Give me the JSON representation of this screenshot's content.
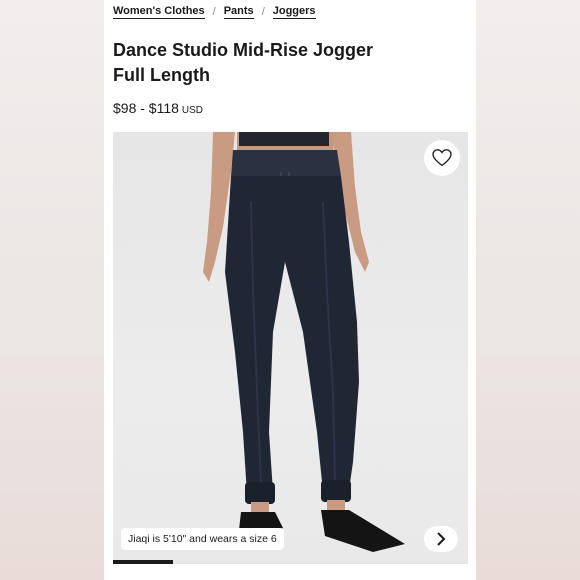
{
  "breadcrumb": {
    "items": [
      "Women's Clothes",
      "Pants",
      "Joggers"
    ],
    "separator": "/"
  },
  "product": {
    "title_line1": "Dance Studio Mid-Rise Jogger",
    "title_line2": "Full Length",
    "price": "$98 - $118",
    "currency": "USD"
  },
  "gallery": {
    "caption": "Jiaqi is 5'10\" and wears a size 6",
    "progress_fraction": 0.17,
    "wishlist_icon": "heart-outline-icon",
    "next_icon": "chevron-right-icon"
  },
  "colors": {
    "pants": "#1f2634",
    "accent": "#1a1a1a"
  }
}
